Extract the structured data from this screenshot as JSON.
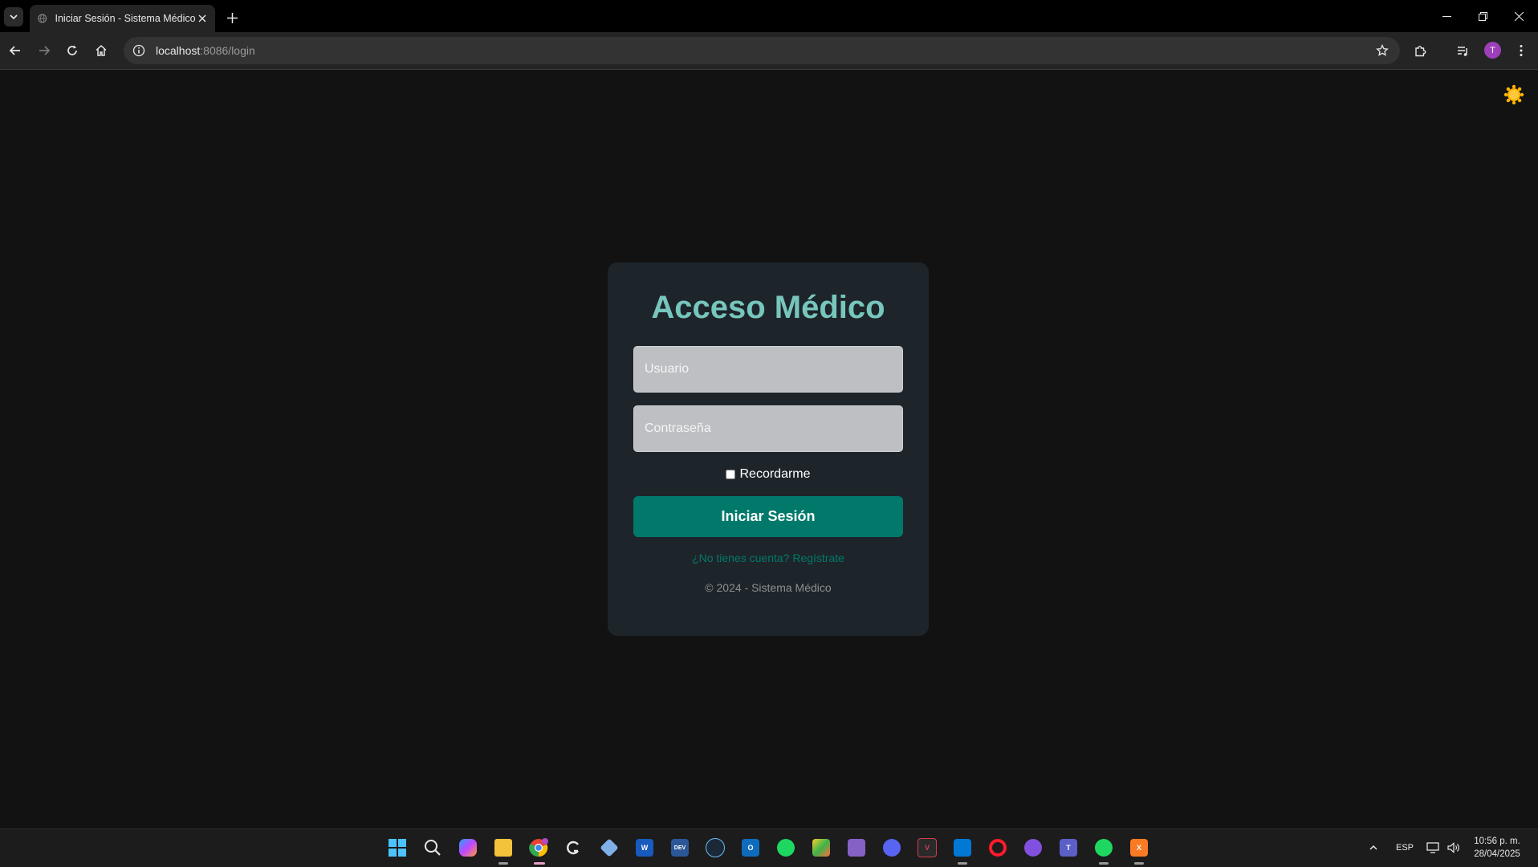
{
  "browser": {
    "tab_title": "Iniciar Sesión - Sistema Médico",
    "url_host": "localhost",
    "url_rest": ":8086/login",
    "profile_initial": "T"
  },
  "login": {
    "title": "Acceso Médico",
    "username_placeholder": "Usuario",
    "password_placeholder": "Contraseña",
    "remember_label": "Recordarme",
    "remember_checked": false,
    "submit_label": "Iniciar Sesión",
    "register_link": "¿No tienes cuenta? Regístrate",
    "footer": "© 2024 - Sistema Médico"
  },
  "theme": {
    "toggle_icon": "sun-icon",
    "accent": "#00796b",
    "title_color": "#77c6bd",
    "card_bg": "#1e252a",
    "page_bg": "#121212"
  },
  "taskbar": {
    "apps": [
      "windows-start-icon",
      "search-icon",
      "copilot-icon",
      "file-explorer-icon",
      "chrome-icon",
      "github-copilot-icon",
      "3d-viewer-icon",
      "word-icon",
      "dev-home-icon",
      "steam-icon",
      "outlook-icon",
      "spotify-icon",
      "paint-icon",
      "visual-studio-icon",
      "discord-icon",
      "vivaldi-icon",
      "vscode-icon",
      "opera-icon",
      "github-desktop-icon",
      "teams-icon",
      "spotify-icon",
      "xampp-icon"
    ],
    "language": "ESP",
    "time": "10:56 p. m.",
    "date": "28/04/2025"
  }
}
